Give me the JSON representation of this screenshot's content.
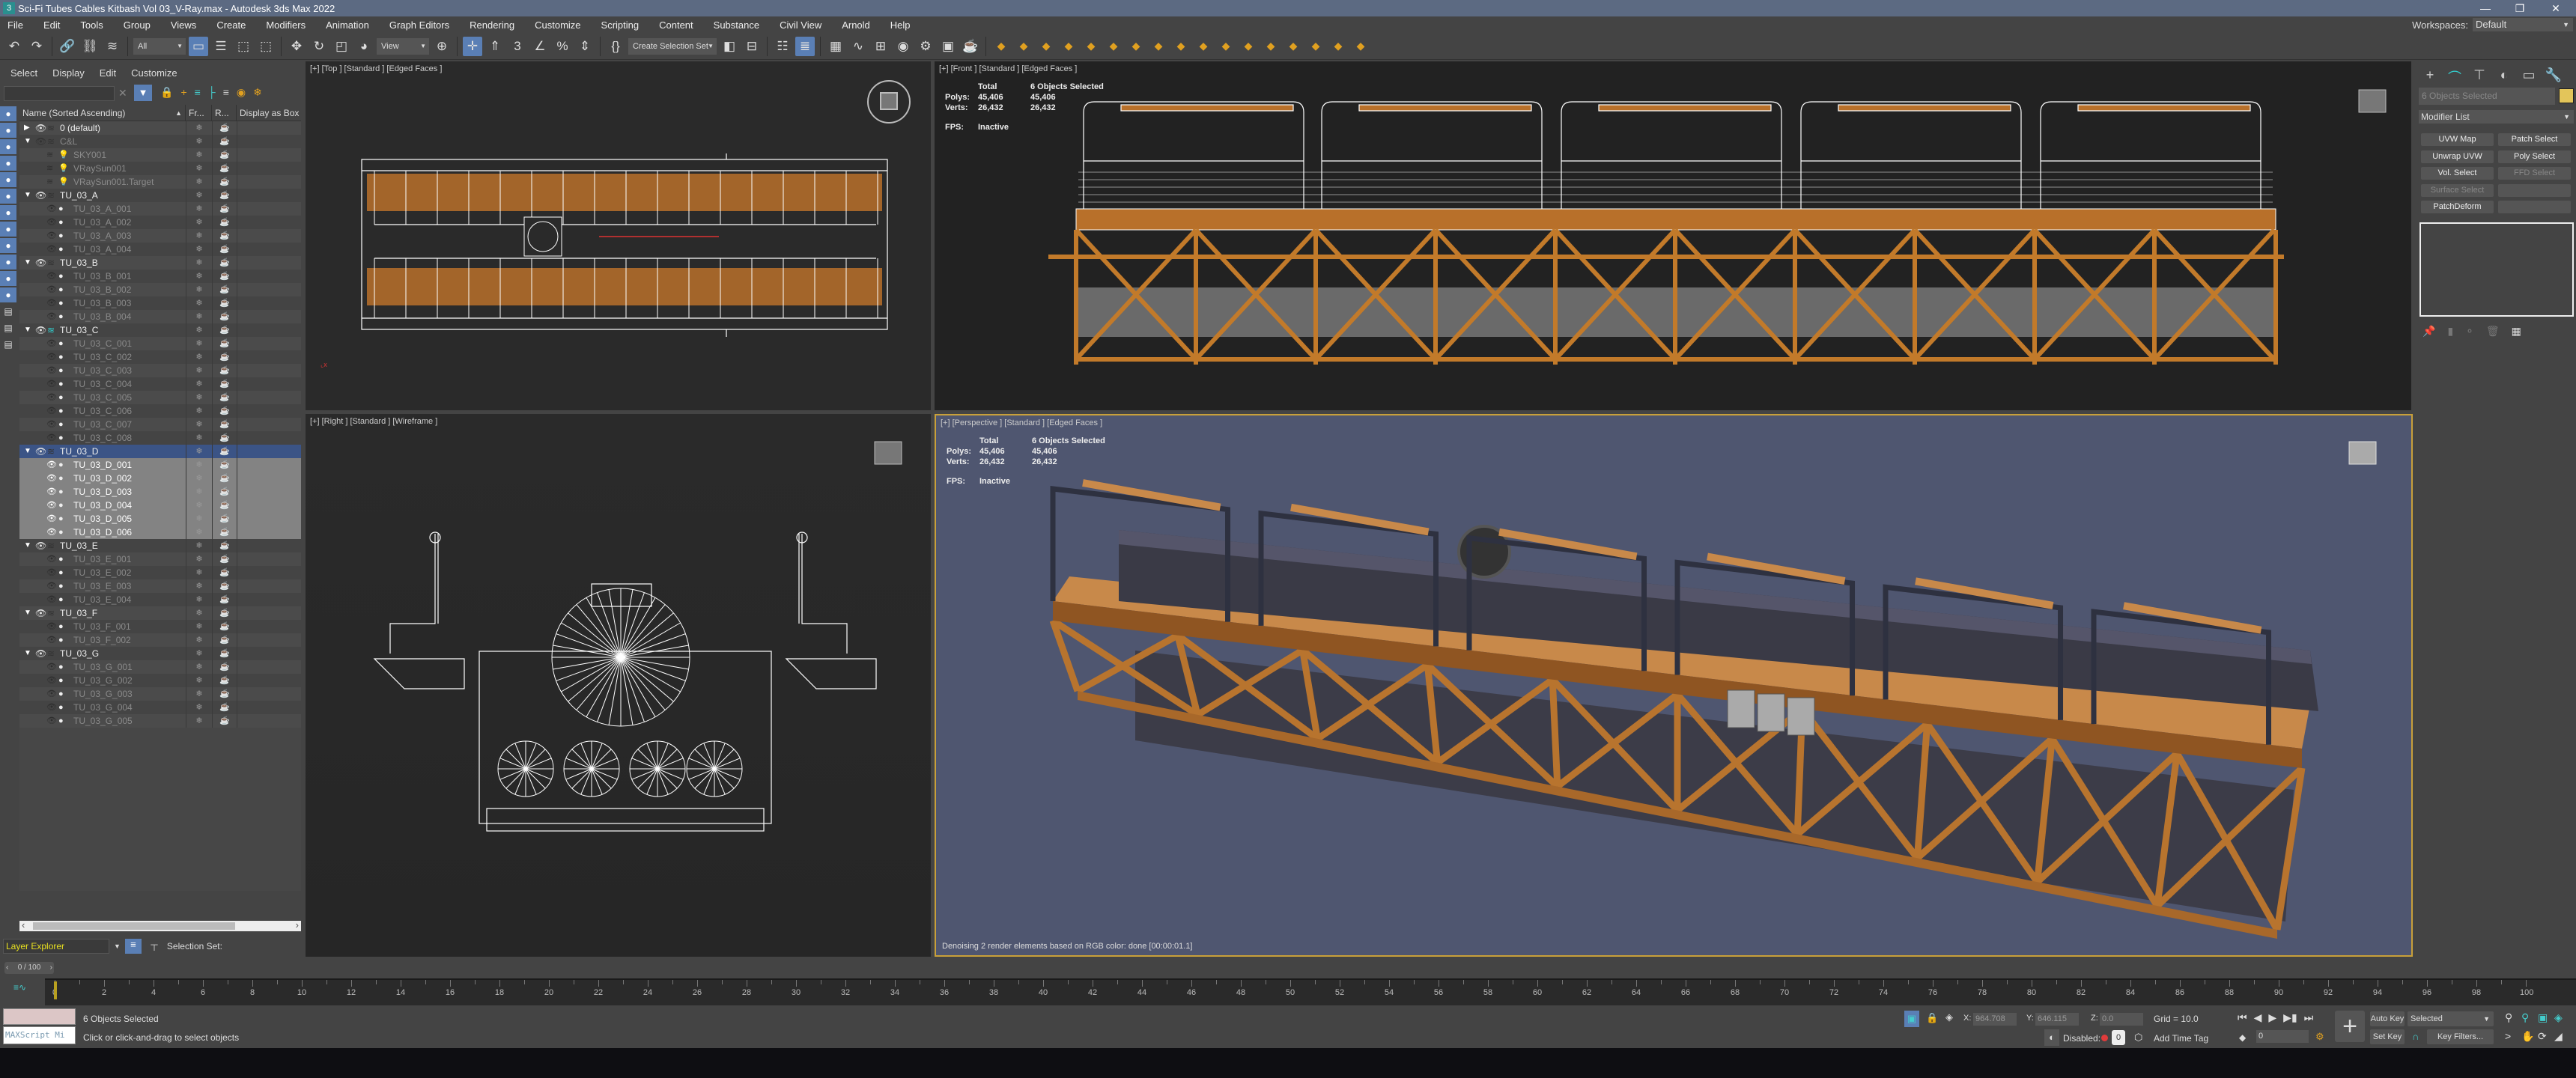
{
  "window": {
    "title": "Sci-Fi Tubes Cables Kitbash Vol 03_V-Ray.max - Autodesk 3ds Max 2022",
    "app_icon": "3ds-max-icon"
  },
  "menu": [
    "File",
    "Edit",
    "Tools",
    "Group",
    "Views",
    "Create",
    "Modifiers",
    "Animation",
    "Graph Editors",
    "Rendering",
    "Customize",
    "Scripting",
    "Content",
    "Substance",
    "Civil View",
    "Arnold",
    "Help"
  ],
  "workspaces": {
    "label": "Workspaces:",
    "value": "Default"
  },
  "toolbar": {
    "selection_filter": "All",
    "ref_coord": "View",
    "named_selection": "Create Selection Set",
    "icons": [
      "undo-icon",
      "redo-icon",
      "|",
      "link-icon",
      "unlink-icon",
      "bind-spacewarp-icon",
      "|",
      "FILTER",
      "select-object-icon",
      "select-by-name-icon",
      "rect-region-icon",
      "window-crossing-icon",
      "|",
      "move-icon",
      "rotate-icon",
      "scale-icon",
      "placement-icon",
      "REF",
      "pivot-icon",
      "|",
      "select-manipulate-icon",
      "keyboard-shortcut-icon",
      "snap-3d-icon",
      "angle-snap-icon",
      "percent-snap-icon",
      "spinner-snap-icon",
      "|",
      "edit-named-sel-icon",
      "NAMED",
      "mirror-icon",
      "align-icon",
      "|",
      "scene-explorer-icon",
      "layer-explorer-icon",
      "|",
      "ribbon-icon",
      "curve-editor-icon",
      "schematic-icon",
      "material-editor-icon",
      "render-setup-icon",
      "rendered-frame-icon",
      "render-icon",
      "|",
      "vray-icon",
      "vray-light-icon",
      "vray-sun-icon",
      "vray-cam-icon",
      "vray-fb-icon",
      "vray-lister-icon",
      "vray-sky-icon",
      "vray-mat-icon",
      "vray-proxy-icon",
      "vray-fur-icon",
      "vray-plane-icon",
      "vray-sphere-icon",
      "vray-mesh-icon",
      "vray-clipper-icon",
      "vray-ies-icon",
      "vray-ambient-icon",
      "vray-dome-icon"
    ]
  },
  "explorer": {
    "menu": [
      "Select",
      "Display",
      "Edit",
      "Customize"
    ],
    "columns": [
      "Name (Sorted Ascending)",
      "Fr...",
      "R...",
      "Display as Box"
    ],
    "rows": [
      {
        "name": "0 (default)",
        "level": 0,
        "type": "layer",
        "expand": "collapsed",
        "dim": false
      },
      {
        "name": "C&L",
        "level": 0,
        "type": "layer",
        "expand": "expanded",
        "dim": true
      },
      {
        "name": "SKY001",
        "level": 1,
        "type": "light",
        "dim": true
      },
      {
        "name": "VRaySun001",
        "level": 1,
        "type": "light",
        "dim": true
      },
      {
        "name": "VRaySun001.Target",
        "level": 1,
        "type": "light",
        "dim": true
      },
      {
        "name": "TU_03_A",
        "level": 0,
        "type": "layer",
        "expand": "expanded"
      },
      {
        "name": "TU_03_A_001",
        "level": 1,
        "type": "obj",
        "dim": true
      },
      {
        "name": "TU_03_A_002",
        "level": 1,
        "type": "obj",
        "dim": true
      },
      {
        "name": "TU_03_A_003",
        "level": 1,
        "type": "obj",
        "dim": true
      },
      {
        "name": "TU_03_A_004",
        "level": 1,
        "type": "obj",
        "dim": true
      },
      {
        "name": "TU_03_B",
        "level": 0,
        "type": "layer",
        "expand": "expanded"
      },
      {
        "name": "TU_03_B_001",
        "level": 1,
        "type": "obj",
        "dim": true
      },
      {
        "name": "TU_03_B_002",
        "level": 1,
        "type": "obj",
        "dim": true
      },
      {
        "name": "TU_03_B_003",
        "level": 1,
        "type": "obj",
        "dim": true
      },
      {
        "name": "TU_03_B_004",
        "level": 1,
        "type": "obj",
        "dim": true
      },
      {
        "name": "TU_03_C",
        "level": 0,
        "type": "layer",
        "expand": "expanded",
        "current": true
      },
      {
        "name": "TU_03_C_001",
        "level": 1,
        "type": "obj",
        "dim": true
      },
      {
        "name": "TU_03_C_002",
        "level": 1,
        "type": "obj",
        "dim": true
      },
      {
        "name": "TU_03_C_003",
        "level": 1,
        "type": "obj",
        "dim": true
      },
      {
        "name": "TU_03_C_004",
        "level": 1,
        "type": "obj",
        "dim": true
      },
      {
        "name": "TU_03_C_005",
        "level": 1,
        "type": "obj",
        "dim": true
      },
      {
        "name": "TU_03_C_006",
        "level": 1,
        "type": "obj",
        "dim": true
      },
      {
        "name": "TU_03_C_007",
        "level": 1,
        "type": "obj",
        "dim": true
      },
      {
        "name": "TU_03_C_008",
        "level": 1,
        "type": "obj",
        "dim": true
      },
      {
        "name": "TU_03_D",
        "level": 0,
        "type": "layer",
        "expand": "expanded",
        "selected": true
      },
      {
        "name": "TU_03_D_001",
        "level": 1,
        "type": "obj",
        "highlight": true,
        "visible": true
      },
      {
        "name": "TU_03_D_002",
        "level": 1,
        "type": "obj",
        "highlight": true,
        "visible": true
      },
      {
        "name": "TU_03_D_003",
        "level": 1,
        "type": "obj",
        "highlight": true,
        "visible": true
      },
      {
        "name": "TU_03_D_004",
        "level": 1,
        "type": "obj",
        "highlight": true,
        "visible": true
      },
      {
        "name": "TU_03_D_005",
        "level": 1,
        "type": "obj",
        "highlight": true,
        "visible": true
      },
      {
        "name": "TU_03_D_006",
        "level": 1,
        "type": "obj",
        "highlight": true,
        "visible": true
      },
      {
        "name": "TU_03_E",
        "level": 0,
        "type": "layer",
        "expand": "expanded"
      },
      {
        "name": "TU_03_E_001",
        "level": 1,
        "type": "obj",
        "dim": true
      },
      {
        "name": "TU_03_E_002",
        "level": 1,
        "type": "obj",
        "dim": true
      },
      {
        "name": "TU_03_E_003",
        "level": 1,
        "type": "obj",
        "dim": true
      },
      {
        "name": "TU_03_E_004",
        "level": 1,
        "type": "obj",
        "dim": true
      },
      {
        "name": "TU_03_F",
        "level": 0,
        "type": "layer",
        "expand": "expanded"
      },
      {
        "name": "TU_03_F_001",
        "level": 1,
        "type": "obj",
        "dim": true
      },
      {
        "name": "TU_03_F_002",
        "level": 1,
        "type": "obj",
        "dim": true
      },
      {
        "name": "TU_03_G",
        "level": 0,
        "type": "layer",
        "expand": "expanded"
      },
      {
        "name": "TU_03_G_001",
        "level": 1,
        "type": "obj",
        "dim": true
      },
      {
        "name": "TU_03_G_002",
        "level": 1,
        "type": "obj",
        "dim": true
      },
      {
        "name": "TU_03_G_003",
        "level": 1,
        "type": "obj",
        "dim": true
      },
      {
        "name": "TU_03_G_004",
        "level": 1,
        "type": "obj",
        "dim": true
      },
      {
        "name": "TU_03_G_005",
        "level": 1,
        "type": "obj",
        "dim": true
      }
    ],
    "footer": {
      "explorer_type": "Layer Explorer",
      "selection_set_label": "Selection Set:"
    }
  },
  "viewports": {
    "top": {
      "label": "[+] [Top ] [Standard ] [Edged Faces ]"
    },
    "front": {
      "label": "[+] [Front ] [Standard ] [Edged Faces ]"
    },
    "right": {
      "label": "[+] [Right ] [Standard ] [Wireframe ]"
    },
    "perspective": {
      "label": "[+] [Perspective ] [Standard ] [Edged Faces ]",
      "message": "Denoising 2 render elements based on RGB color: done [00:00:01.1]"
    },
    "stats": {
      "total_label": "Total",
      "selected_label": "6 Objects Selected",
      "polys_label": "Polys:",
      "polys_total": "45,406",
      "polys_selected": "45,406",
      "verts_label": "Verts:",
      "verts_total": "26,432",
      "verts_selected": "26,432",
      "fps_label": "FPS:",
      "fps_value": "Inactive"
    }
  },
  "command_panel": {
    "tabs": [
      "create-tab-icon",
      "modify-tab-icon",
      "hierarchy-tab-icon",
      "motion-tab-icon",
      "display-tab-icon",
      "utilities-tab-icon"
    ],
    "object_name": "6 Objects Selected",
    "object_color": "#e3c55a",
    "modifier_list": "Modifier List",
    "buttons": [
      {
        "label": "UVW Map",
        "enabled": true
      },
      {
        "label": "Patch Select",
        "enabled": true
      },
      {
        "label": "Unwrap UVW",
        "enabled": true
      },
      {
        "label": "Poly Select",
        "enabled": true
      },
      {
        "label": "Vol. Select",
        "enabled": true
      },
      {
        "label": "FFD Select",
        "enabled": false
      },
      {
        "label": "Surface Select",
        "enabled": false
      },
      {
        "label": "",
        "enabled": false
      },
      {
        "label": "PatchDeform",
        "enabled": true
      },
      {
        "label": "",
        "enabled": false
      }
    ]
  },
  "timeline": {
    "current": "0 / 100",
    "start": 0,
    "end": 100,
    "label_step": 2
  },
  "status": {
    "selection": "6 Objects Selected",
    "prompt": "Click or click-and-drag to select objects",
    "maxscript": "MAXScript Mi",
    "x_label": "X:",
    "x": "964.708",
    "y_label": "Y:",
    "y": "646.115",
    "z_label": "Z:",
    "z": "0.0",
    "grid": "Grid = 10.0",
    "disabled_label": "Disabled:",
    "add_time_tag": "Add Time Tag",
    "frame": "0",
    "auto_key": "Auto Key",
    "set_key": "Set Key",
    "key_mode": "Selected",
    "key_filters": "Key Filters..."
  },
  "colors": {
    "accent": "#5a7fb5",
    "active_viewport_border": "#c8a03a",
    "wood": "#c27a2a",
    "perspective_bg": "#4f5670"
  }
}
